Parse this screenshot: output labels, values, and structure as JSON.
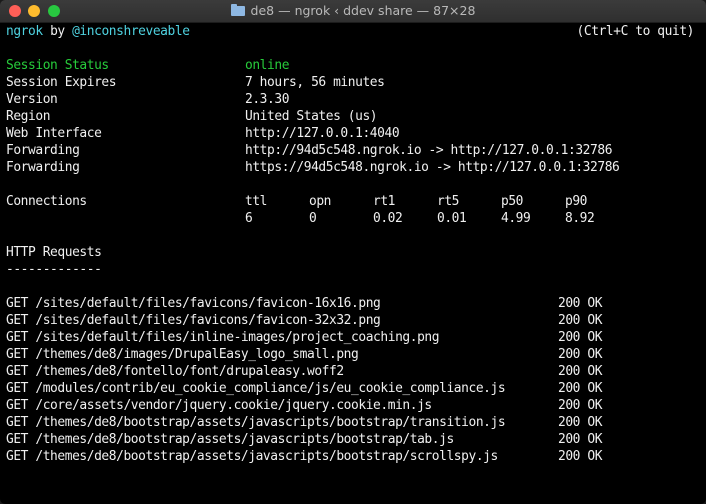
{
  "window": {
    "title": "de8 — ngrok ‹ ddev share — 87×28",
    "folder_icon": "folder-icon"
  },
  "header": {
    "app": "ngrok",
    "by": "by",
    "author": "@inconshreveable",
    "quit_hint": "(Ctrl+C to quit)"
  },
  "session": {
    "status_label": "Session Status",
    "status_value": "online",
    "expires_label": "Session Expires",
    "expires_value": "7 hours, 56 minutes",
    "version_label": "Version",
    "version_value": "2.3.30",
    "region_label": "Region",
    "region_value": "United States (us)",
    "web_label": "Web Interface",
    "web_value": "http://127.0.0.1:4040",
    "fwd1_label": "Forwarding",
    "fwd1_value": "http://94d5c548.ngrok.io -> http://127.0.0.1:32786",
    "fwd2_label": "Forwarding",
    "fwd2_value": "https://94d5c548.ngrok.io -> http://127.0.0.1:32786"
  },
  "connections": {
    "label": "Connections",
    "headers": [
      "ttl",
      "opn",
      "rt1",
      "rt5",
      "p50",
      "p90"
    ],
    "values": [
      "6",
      "0",
      "0.02",
      "0.01",
      "4.99",
      "8.92"
    ]
  },
  "http": {
    "title": "HTTP Requests",
    "underline": "-------------",
    "requests": [
      {
        "line": "GET /sites/default/files/favicons/favicon-16x16.png",
        "status": "200 OK"
      },
      {
        "line": "GET /sites/default/files/favicons/favicon-32x32.png",
        "status": "200 OK"
      },
      {
        "line": "GET /sites/default/files/inline-images/project_coaching.png",
        "status": "200 OK"
      },
      {
        "line": "GET /themes/de8/images/DrupalEasy_logo_small.png",
        "status": "200 OK"
      },
      {
        "line": "GET /themes/de8/fontello/font/drupaleasy.woff2",
        "status": "200 OK"
      },
      {
        "line": "GET /modules/contrib/eu_cookie_compliance/js/eu_cookie_compliance.js",
        "status": "200 OK"
      },
      {
        "line": "GET /core/assets/vendor/jquery.cookie/jquery.cookie.min.js",
        "status": "200 OK"
      },
      {
        "line": "GET /themes/de8/bootstrap/assets/javascripts/bootstrap/transition.js",
        "status": "200 OK"
      },
      {
        "line": "GET /themes/de8/bootstrap/assets/javascripts/bootstrap/tab.js",
        "status": "200 OK"
      },
      {
        "line": "GET /themes/de8/bootstrap/assets/javascripts/bootstrap/scrollspy.js",
        "status": "200 OK"
      }
    ]
  }
}
